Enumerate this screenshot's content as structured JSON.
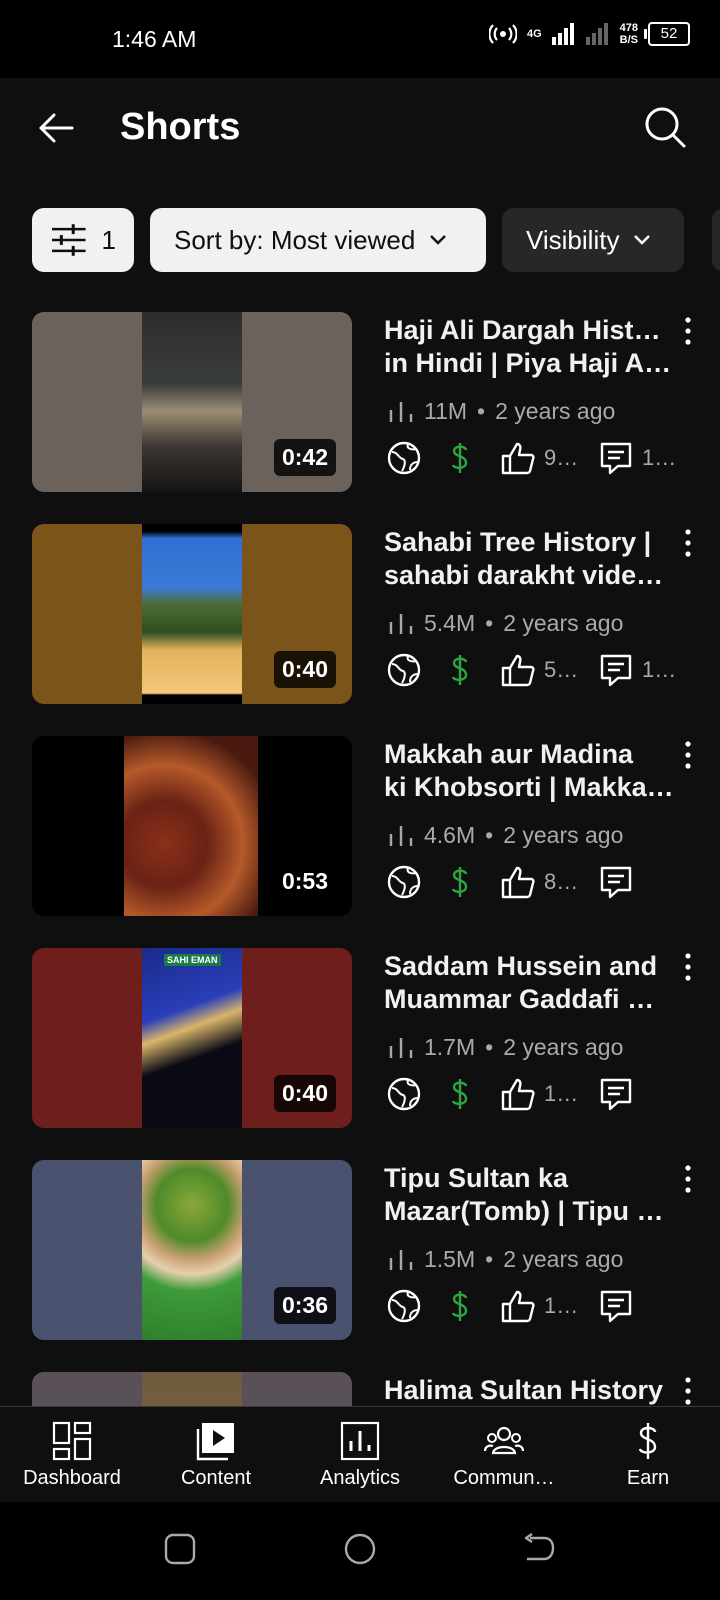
{
  "status_bar": {
    "time": "1:46 AM",
    "network": "4G",
    "speed_top": "478",
    "speed_bottom": "B/S",
    "battery": "52"
  },
  "header": {
    "title": "Shorts"
  },
  "filters": {
    "filter_count": "1",
    "sort_label": "Sort by: Most viewed",
    "visibility_label": "Visibility"
  },
  "videos": [
    {
      "title_line1": "Haji Ali Dargah History",
      "title_line2": "in Hindi | Piya Haji Ali…",
      "views": "11M",
      "age": "2 years ago",
      "likes": "9…",
      "comments": "1…",
      "duration": "0:42",
      "bg": "#6b625b"
    },
    {
      "title_line1": "Sahabi Tree History |",
      "title_line2": "sahabi darakht video…",
      "views": "5.4M",
      "age": "2 years ago",
      "likes": "5…",
      "comments": "1…",
      "duration": "0:40",
      "bg": "#7a5418"
    },
    {
      "title_line1": "Makkah aur Madina",
      "title_line2": "ki Khobsorti | Makka…",
      "views": "4.6M",
      "age": "2 years ago",
      "likes": "8…",
      "comments": "",
      "duration": "0:53",
      "bg": "#000000"
    },
    {
      "title_line1": "Saddam Hussein and",
      "title_line2": "Muammar Gaddafi W…",
      "views": "1.7M",
      "age": "2 years ago",
      "likes": "1…",
      "comments": "",
      "duration": "0:40",
      "bg": "#6e1f1c"
    },
    {
      "title_line1": "Tipu Sultan ka",
      "title_line2": "Mazar(Tomb) | Tipu …",
      "views": "1.5M",
      "age": "2 years ago",
      "likes": "1…",
      "comments": "",
      "duration": "0:36",
      "bg": "#4a5270"
    },
    {
      "title_line1": "Halima Sultan History",
      "title_line2": "",
      "views": "",
      "age": "",
      "likes": "",
      "comments": "",
      "duration": "",
      "bg": "#5a5058"
    }
  ],
  "meta_separator": "•",
  "thumb_badge": "SAHI EMAN",
  "bottom_nav": [
    "Dashboard",
    "Content",
    "Analytics",
    "Commun…",
    "Earn"
  ],
  "colors": {
    "background": "#0f0f0f",
    "chip_light": "#f1f1f1",
    "chip_dark": "#272727",
    "monetization_green": "#2ba640",
    "secondary_text": "#aaaaaa"
  }
}
